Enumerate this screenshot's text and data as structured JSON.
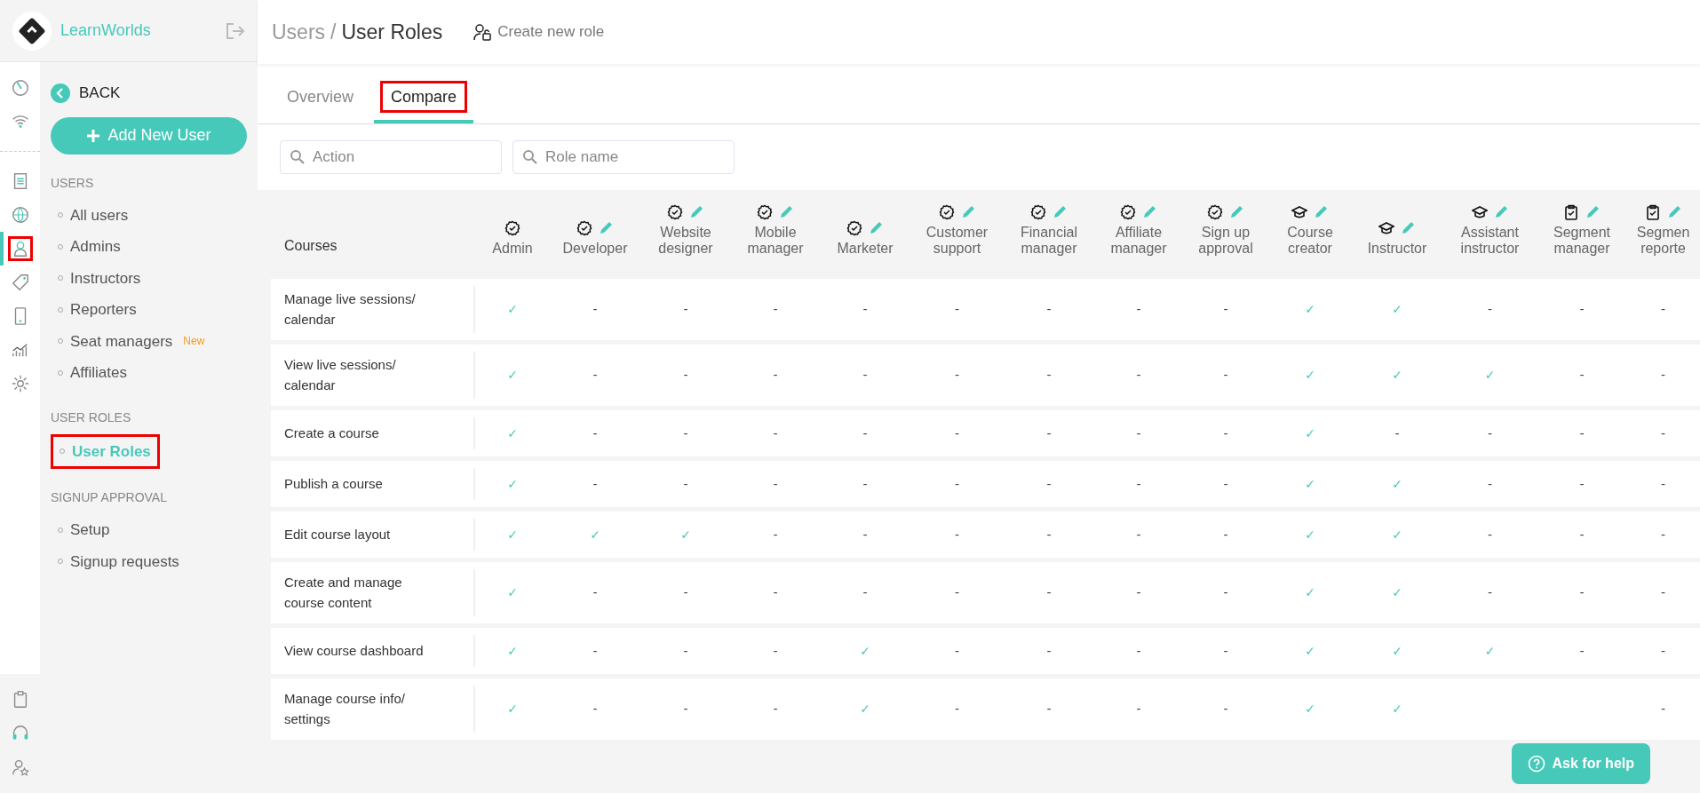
{
  "brand": {
    "name": "LearnWorlds"
  },
  "rail": {
    "top": [
      {
        "kind": "gauge",
        "selected": false,
        "highlighted": false
      },
      {
        "kind": "wifi",
        "selected": false,
        "highlighted": false
      }
    ],
    "main": [
      {
        "kind": "page",
        "selected": false,
        "highlighted": false
      },
      {
        "kind": "globe",
        "selected": false,
        "highlighted": false
      },
      {
        "kind": "user",
        "selected": true,
        "highlighted": true
      },
      {
        "kind": "tag",
        "selected": false,
        "highlighted": false
      },
      {
        "kind": "phone",
        "selected": false,
        "highlighted": false
      },
      {
        "kind": "chart",
        "selected": false,
        "highlighted": false
      },
      {
        "kind": "gear",
        "selected": false,
        "highlighted": false
      }
    ],
    "bottom": [
      {
        "kind": "clipboard",
        "selected": false,
        "highlighted": false
      },
      {
        "kind": "headset",
        "selected": false,
        "highlighted": false
      },
      {
        "kind": "userstar",
        "selected": false,
        "highlighted": false
      }
    ]
  },
  "sidebar": {
    "back": "BACK",
    "add_button": "Add New User",
    "sections": [
      {
        "title": "USERS",
        "items": [
          {
            "label": "All users",
            "selected": false,
            "highlighted": false
          },
          {
            "label": "Admins",
            "selected": false,
            "highlighted": false
          },
          {
            "label": "Instructors",
            "selected": false,
            "highlighted": false
          },
          {
            "label": "Reporters",
            "selected": false,
            "highlighted": false
          },
          {
            "label": "Seat managers",
            "badge": "New",
            "selected": false,
            "highlighted": false
          },
          {
            "label": "Affiliates",
            "selected": false,
            "highlighted": false
          }
        ]
      },
      {
        "title": "USER ROLES",
        "items": [
          {
            "label": "User Roles",
            "selected": true,
            "highlighted": true
          }
        ]
      },
      {
        "title": "SIGNUP APPROVAL",
        "items": [
          {
            "label": "Setup",
            "selected": false,
            "highlighted": false
          },
          {
            "label": "Signup requests",
            "selected": false,
            "highlighted": false
          }
        ]
      }
    ]
  },
  "header": {
    "parent": "Users",
    "separator": "/",
    "title": "User Roles",
    "action": "Create new role"
  },
  "tabs": [
    {
      "label": "Overview",
      "selected": false,
      "highlighted": false
    },
    {
      "label": "Compare",
      "selected": true,
      "highlighted": true
    }
  ],
  "filters": [
    {
      "placeholder": "Action"
    },
    {
      "placeholder": "Role name"
    }
  ],
  "table": {
    "group": "Courses",
    "roles": [
      {
        "name": "Admin",
        "kind": "gear",
        "editable": false
      },
      {
        "name": "Developer",
        "kind": "gear",
        "editable": true
      },
      {
        "name": "Website designer",
        "kind": "gear",
        "editable": true
      },
      {
        "name": "Mobile manager",
        "kind": "gear",
        "editable": true
      },
      {
        "name": "Marketer",
        "kind": "gear",
        "editable": true
      },
      {
        "name": "Customer support",
        "kind": "gear",
        "editable": true
      },
      {
        "name": "Financial manager",
        "kind": "gear",
        "editable": true
      },
      {
        "name": "Affiliate manager",
        "kind": "gear",
        "editable": true
      },
      {
        "name": "Sign up approval",
        "kind": "gear",
        "editable": true
      },
      {
        "name": "Course creator",
        "kind": "cap",
        "editable": true
      },
      {
        "name": "Instructor",
        "kind": "cap",
        "editable": true
      },
      {
        "name": "Assistant instructor",
        "kind": "cap",
        "editable": true
      },
      {
        "name": "Segment manager",
        "kind": "clipboard",
        "editable": true
      },
      {
        "name": "Segmen reporte",
        "kind": "clipboard",
        "editable": true
      }
    ],
    "rows": [
      {
        "action": "Manage live sessions/ calendar",
        "cells": [
          "✓",
          "-",
          "-",
          "-",
          "-",
          "-",
          "-",
          "-",
          "-",
          "✓",
          "✓",
          "-",
          "-",
          "-"
        ]
      },
      {
        "action": "View live sessions/ calendar",
        "cells": [
          "✓",
          "-",
          "-",
          "-",
          "-",
          "-",
          "-",
          "-",
          "-",
          "✓",
          "✓",
          "✓",
          "-",
          "-"
        ]
      },
      {
        "action": "Create a course",
        "cells": [
          "✓",
          "-",
          "-",
          "-",
          "-",
          "-",
          "-",
          "-",
          "-",
          "✓",
          "-",
          "-",
          "-",
          "-"
        ]
      },
      {
        "action": "Publish a course",
        "cells": [
          "✓",
          "-",
          "-",
          "-",
          "-",
          "-",
          "-",
          "-",
          "-",
          "✓",
          "✓",
          "-",
          "-",
          "-"
        ]
      },
      {
        "action": "Edit course layout",
        "cells": [
          "✓",
          "✓",
          "✓",
          "-",
          "-",
          "-",
          "-",
          "-",
          "-",
          "✓",
          "✓",
          "-",
          "-",
          "-"
        ]
      },
      {
        "action": "Create and manage course content",
        "cells": [
          "✓",
          "-",
          "-",
          "-",
          "-",
          "-",
          "-",
          "-",
          "-",
          "✓",
          "✓",
          "-",
          "-",
          "-"
        ]
      },
      {
        "action": "View course dashboard",
        "cells": [
          "✓",
          "-",
          "-",
          "-",
          "✓",
          "-",
          "-",
          "-",
          "-",
          "✓",
          "✓",
          "✓",
          "-",
          "-"
        ]
      },
      {
        "action": "Manage course info/ settings",
        "cells": [
          "✓",
          "-",
          "-",
          "-",
          "✓",
          "-",
          "-",
          "-",
          "-",
          "✓",
          "✓",
          null,
          null,
          "-"
        ]
      }
    ]
  },
  "help_button": {
    "label": "Ask for help"
  }
}
